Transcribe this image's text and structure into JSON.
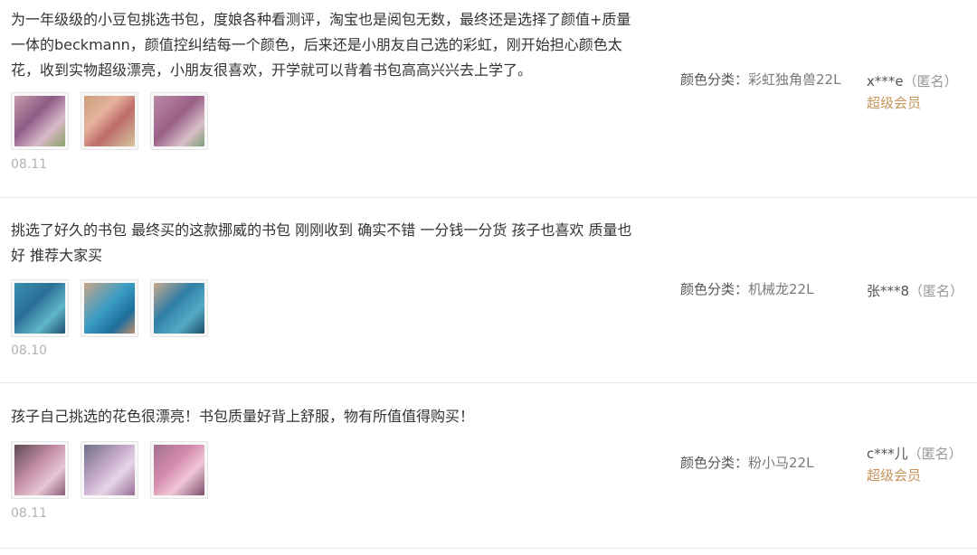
{
  "reviews": [
    {
      "text": "为一年级级的小豆包挑选书包，度娘各种看测评，淘宝也是阅包无数，最终还是选择了颜值+质量一体的beckmann，颜值控纠结每一个颜色，后来还是小朋友自己选的彩虹，刚开始担心颜色太花，收到实物超级漂亮，小朋友很喜欢，开学就可以背着书包高高兴兴去上学了。",
      "date": "08.11",
      "sku_label": "颜色分类：",
      "sku_value": "彩虹独角兽22L",
      "user": "x***e",
      "anon": "（匿名）",
      "vip": "超级会员"
    },
    {
      "text": "挑选了好久的书包 最终买的这款挪威的书包 刚刚收到 确实不错 一分钱一分货 孩子也喜欢 质量也好 推荐大家买",
      "date": "08.10",
      "sku_label": "颜色分类：",
      "sku_value": "机械龙22L",
      "user": "张***8",
      "anon": "（匿名）",
      "vip": ""
    },
    {
      "text": "孩子自己挑选的花色很漂亮！书包质量好背上舒服，物有所值值得购买！",
      "date": "08.11",
      "sku_label": "颜色分类：",
      "sku_value": "粉小马22L",
      "user": "c***儿",
      "anon": "（匿名）",
      "vip": "超级会员"
    }
  ]
}
